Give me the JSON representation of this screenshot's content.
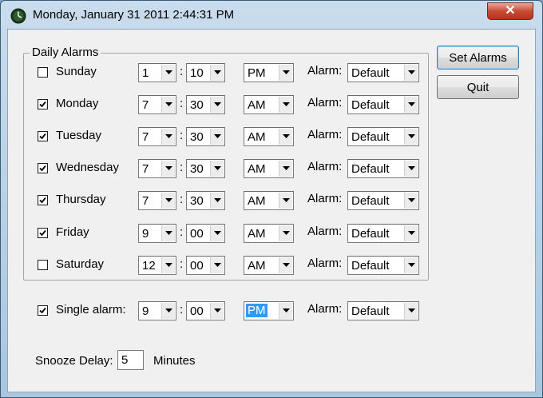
{
  "window": {
    "title": "Monday, January 31 2011  2:44:31 PM"
  },
  "group_title": "Daily Alarms",
  "alarm_label": "Alarm:",
  "days": [
    {
      "label": "Sunday",
      "checked": false,
      "hour": "1",
      "minute": "10",
      "ampm": "PM",
      "alarm": "Default"
    },
    {
      "label": "Monday",
      "checked": true,
      "hour": "7",
      "minute": "30",
      "ampm": "AM",
      "alarm": "Default"
    },
    {
      "label": "Tuesday",
      "checked": true,
      "hour": "7",
      "minute": "30",
      "ampm": "AM",
      "alarm": "Default"
    },
    {
      "label": "Wednesday",
      "checked": true,
      "hour": "7",
      "minute": "30",
      "ampm": "AM",
      "alarm": "Default"
    },
    {
      "label": "Thursday",
      "checked": true,
      "hour": "7",
      "minute": "30",
      "ampm": "AM",
      "alarm": "Default"
    },
    {
      "label": "Friday",
      "checked": true,
      "hour": "9",
      "minute": "00",
      "ampm": "AM",
      "alarm": "Default"
    },
    {
      "label": "Saturday",
      "checked": false,
      "hour": "12",
      "minute": "00",
      "ampm": "AM",
      "alarm": "Default"
    }
  ],
  "single": {
    "label": "Single alarm:",
    "checked": true,
    "hour": "9",
    "minute": "00",
    "ampm": "PM",
    "alarm": "Default"
  },
  "buttons": {
    "set": "Set Alarms",
    "quit": "Quit"
  },
  "snooze": {
    "label": "Snooze Delay:",
    "value": "5",
    "unit": "Minutes"
  },
  "colors": {
    "selection": "#3399ff",
    "close": "#c84a35"
  }
}
